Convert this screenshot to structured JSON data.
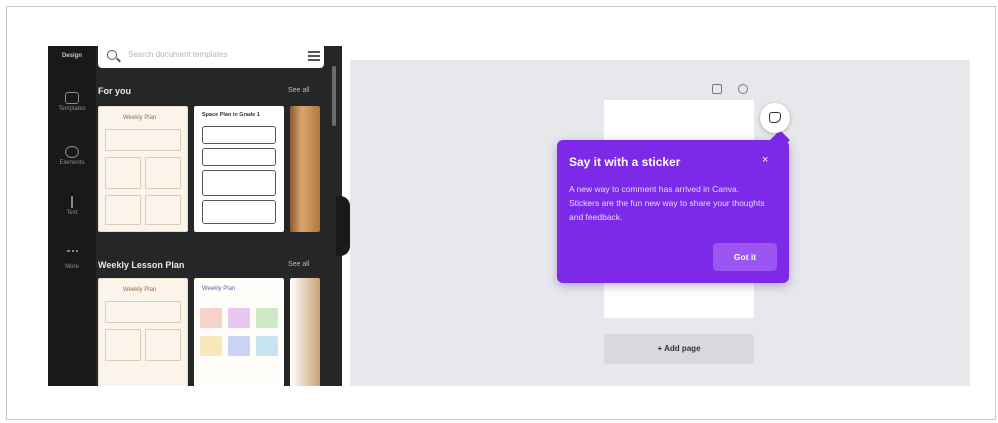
{
  "rail": {
    "top_label": "Design",
    "items": [
      {
        "label": "Templates",
        "icon": "templates-icon"
      },
      {
        "label": "Elements",
        "icon": "elements-icon"
      },
      {
        "label": "Text",
        "icon": "text-icon"
      },
      {
        "label": "More",
        "icon": "more-icon"
      }
    ]
  },
  "search": {
    "placeholder": "Search document templates"
  },
  "sections": [
    {
      "title": "For you",
      "see_all": "See all"
    },
    {
      "title": "Weekly Lesson Plan",
      "see_all": "See all"
    }
  ],
  "thumbnails": {
    "planner_title": "Weekly Plan",
    "space_title": "Space Plan in Grade 1",
    "colors_title": "Weekly Plan"
  },
  "tooltip": {
    "title": "Say it with a sticker",
    "close": "×",
    "body": "A new way to comment has arrived in Canva. Stickers are the fun new way to share your thoughts and feedback.",
    "button": "Got it"
  },
  "canvas": {
    "add_page": "+ Add page"
  },
  "colors": {
    "accent": "#7d2ae8",
    "panel": "#252627",
    "rail": "#18191b",
    "canvas": "#e7e8ec"
  }
}
